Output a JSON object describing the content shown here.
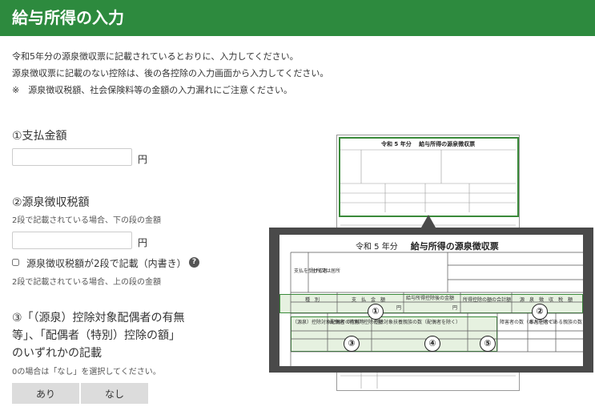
{
  "header": {
    "title": "給与所得の入力"
  },
  "intro": {
    "line1": "令和5年分の源泉徴収票に記載されているとおりに、入力してください。",
    "line2": "源泉徴収票に記載のない控除は、後の各控除の入力画面から入力してください。",
    "line3": "※　源泉徴収税額、社会保険料等の金額の入力漏れにご注意ください。"
  },
  "section1": {
    "title": "①支払金額",
    "input_value": "",
    "unit": "円"
  },
  "section2": {
    "title": "②源泉徴収税額",
    "hint_lower": "2段で記載されている場合、下の段の金額",
    "input_value": "",
    "unit": "円",
    "checkbox_label": "源泉徴収税額が2段で記載（内書き）",
    "help_icon": "?",
    "hint_upper": "2段で記載されている場合、上の段の金額"
  },
  "section3": {
    "line1": "③「（源泉）控除対象配偶者の有無",
    "line2": "等」、「配偶者（特別）控除の額」",
    "line3": "のいずれかの記載",
    "hint": "0の場合は「なし」を選択してください。",
    "options": [
      "あり",
      "なし"
    ]
  },
  "illustration": {
    "small_doc_title": "令和 5 年分　 給与所得の源泉徴収票",
    "zoom_era": "令和  5  年分",
    "zoom_title": "給与所得の源泉徴収票",
    "markers": [
      "①",
      "②",
      "③",
      "④",
      "⑤"
    ],
    "labels": {
      "recipient": "支払を受ける者",
      "address": "住所又は居所",
      "type": "種　別",
      "pay": "支　払　金　額",
      "after_deduction": "給与所得控除後の金額",
      "deduction_total": "所得控除の額の合計額",
      "tax": "源　泉　徴　収　税　額",
      "spouse": "（源泉）控除対象配偶者の有無等",
      "spouse_deduction": "配偶者（特別）控除の額",
      "dependents": "控除対象扶養親族の数（配偶者を除く）",
      "under16": "16歳未満扶養親族の数",
      "disabled": "障害者の数（本人を除く）",
      "nonresident": "非居住者である親族の数",
      "yen": "円"
    }
  },
  "colors": {
    "header_bg": "#2d8a3e",
    "green_line": "#3a8a3a",
    "overlay": "#4a4a4a",
    "button_bg": "#dcdcdc"
  }
}
